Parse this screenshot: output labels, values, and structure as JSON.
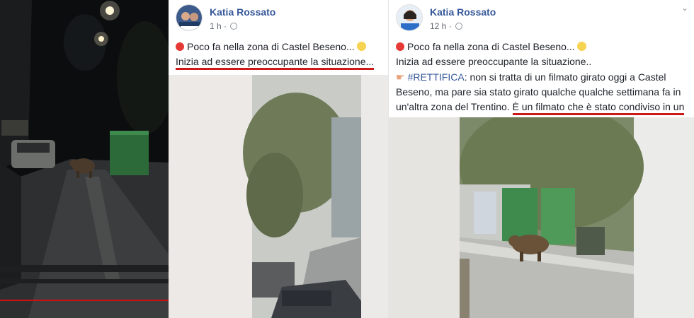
{
  "post1": {
    "author": "Katia Rossato",
    "time": "1 h",
    "line1": "Poco fa nella zona di Castel Beseno...",
    "line2": "Inizia ad essere preoccupante la situazione..."
  },
  "post2": {
    "author": "Katia Rossato",
    "time": "12 h",
    "line1": "Poco fa nella zona di Castel Beseno...",
    "line2": "Inizia ad essere preoccupante la situazione..",
    "hashtag": "#RETTIFICA",
    "rettifica_text": ": non si tratta di un filmato girato oggi a Castel Beseno, ma pare sia stato girato qualche qualche settimana fa in un'altra zona del Trentino. ",
    "underlined_text": "È un filmato che è stato condiviso in un gruppo cittadino."
  },
  "icons": [
    "globe-icon",
    "red-circle-icon",
    "scream-emoji-icon",
    "pointing-hand-icon",
    "chevron-down-icon"
  ],
  "colors": {
    "author": "#365899",
    "underline": "#cc1a1a",
    "text": "#1d2129",
    "meta": "#616770"
  }
}
